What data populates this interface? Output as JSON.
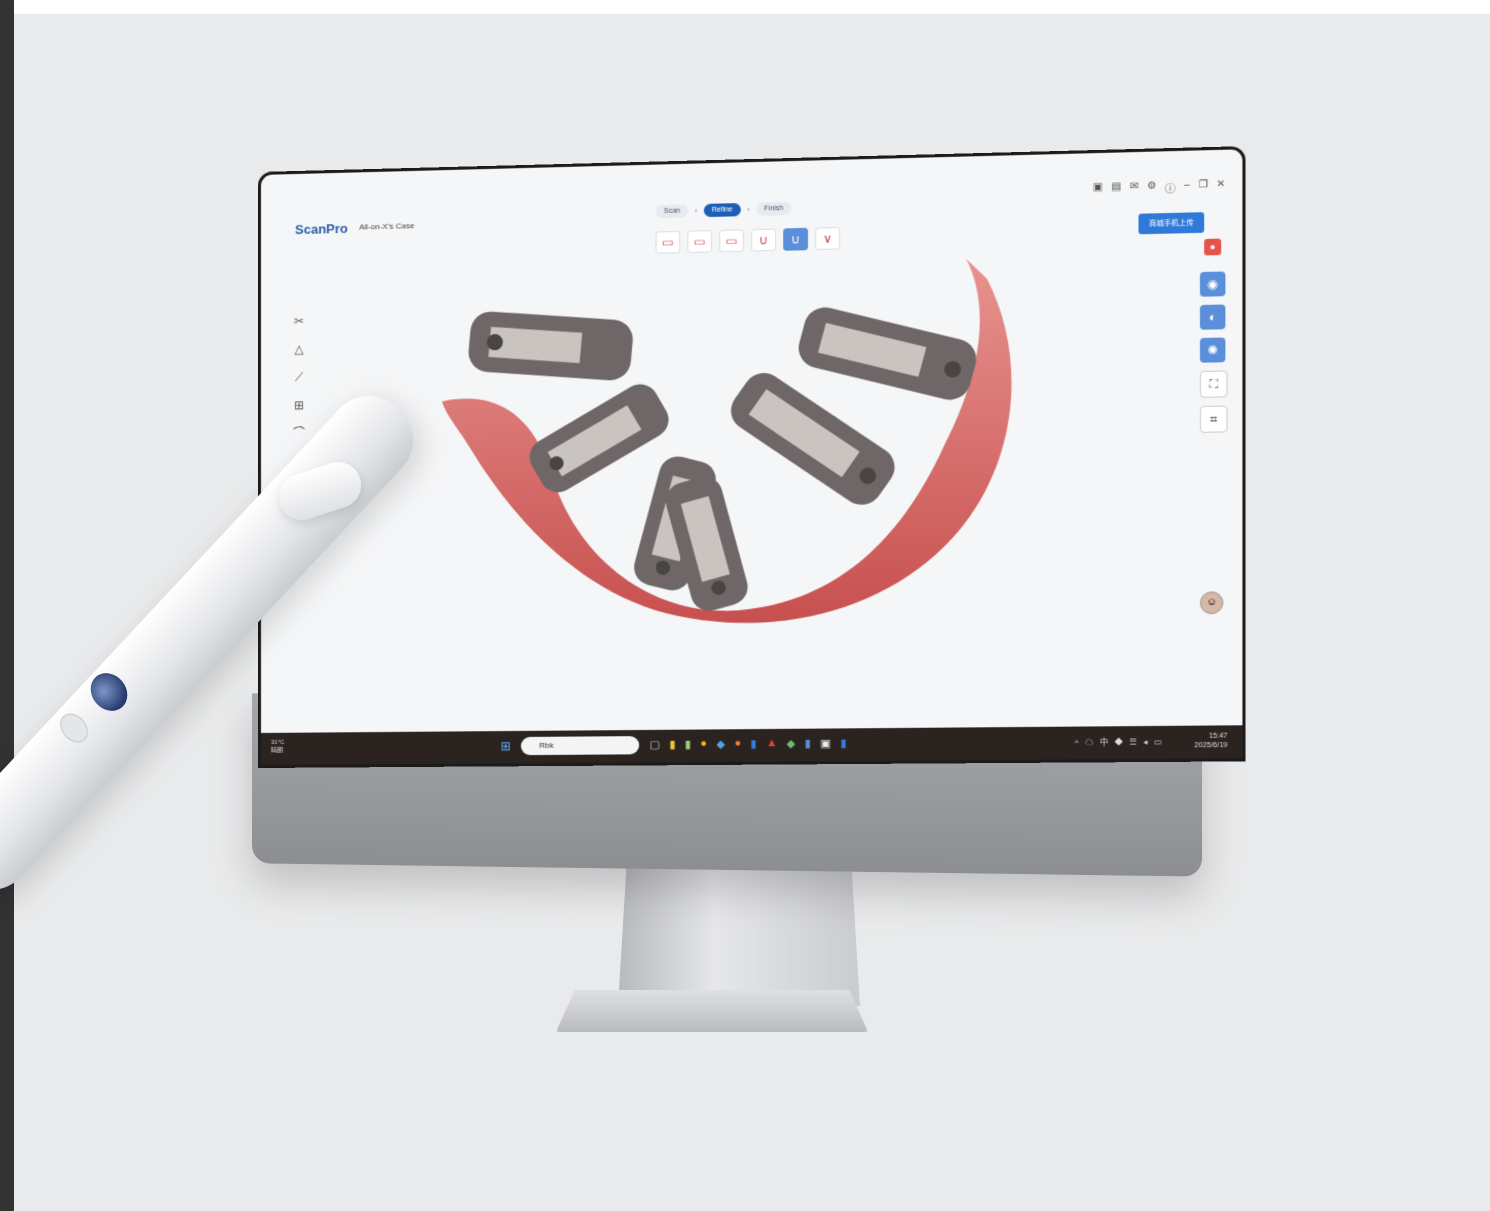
{
  "app": {
    "logo": "ScanPro",
    "case_name": "All-on-X's Case"
  },
  "steps": [
    {
      "label": "Scan"
    },
    {
      "label": "Refine"
    },
    {
      "label": "Finish"
    }
  ],
  "toolbar": {
    "upload_label": "商城手机上传"
  },
  "taskbar": {
    "weather_temp": "31°C",
    "weather_desc": "晴朗",
    "search_placeholder": "Rbk",
    "time": "15:47",
    "date": "2025/6/19"
  },
  "colors": {
    "accent": "#1d5fb8",
    "tool_blue": "#5b8fd9",
    "record_red": "#e5534b"
  },
  "icons": {
    "left_tools": [
      "scissors-icon",
      "triangle-icon",
      "ruler-icon",
      "jaw-icon",
      "scan-area-icon"
    ],
    "right_tools": [
      "color-wheel-icon",
      "texture-icon",
      "light-icon",
      "fit-screen-icon",
      "capture-icon"
    ]
  }
}
